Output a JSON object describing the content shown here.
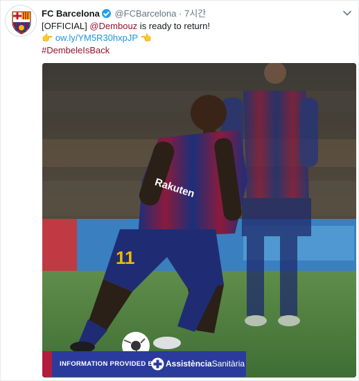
{
  "tweet": {
    "display_name": "FC Barcelona",
    "handle": "@FCBarcelona",
    "separator": "·",
    "time": "7시간",
    "text_prefix": "[OFFICIAL] ",
    "mention": "@Dembouz",
    "text_suffix": " is ready to return!",
    "link": "ow.ly/YM5R30hxpJP",
    "hashtag": "#DembeleIsBack"
  },
  "media": {
    "player_number": "11",
    "shirt_sponsor": "Rakuten",
    "banner_text": "INFORMATION PROVIDED BY",
    "banner_brand_bold": "Assistència",
    "banner_brand": "Sanitària"
  },
  "colors": {
    "link": "#1b95e0",
    "hashtag": "#94122f",
    "verified": "#1da1f2",
    "banner": "#2a3b9c"
  }
}
